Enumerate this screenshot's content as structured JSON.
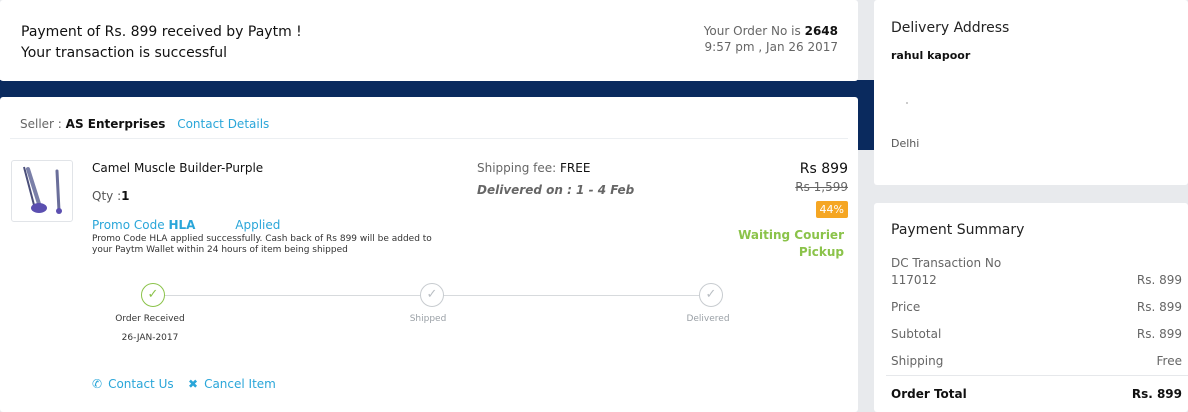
{
  "confirmation": {
    "line1": "Payment of Rs. 899 received by Paytm !",
    "line2": "Your transaction is successful",
    "order_no_label": "Your Order No is",
    "order_no": "2648",
    "timestamp": "9:57 pm , Jan 26 2017"
  },
  "order": {
    "seller_label": "Seller :",
    "seller_name": "AS Enterprises",
    "contact_details": "Contact Details",
    "product_name": "Camel Muscle Builder-Purple",
    "qty_label": "Qty :",
    "qty": "1",
    "promo_label": "Promo Code",
    "promo_code": "HLA",
    "promo_applied": "Applied",
    "promo_note": "Promo Code HLA                    applied successfully. Cash back of Rs 899 will be added to your Paytm Wallet within 24 hours of item being shipped",
    "shipping_fee_label": "Shipping fee:",
    "shipping_fee": "FREE",
    "delivery_text": "Delivered on : 1 - 4 Feb",
    "price": "Rs 899",
    "mrp": "Rs 1,599",
    "discount": "44%",
    "status": "Waiting Courier Pickup",
    "steps": [
      {
        "label": "Order Received",
        "date": "26-JAN-2017",
        "done": true
      },
      {
        "label": "Shipped",
        "date": "",
        "done": false
      },
      {
        "label": "Delivered",
        "date": "",
        "done": false
      }
    ],
    "contact_us": "Contact Us",
    "cancel_item": "Cancel Item",
    "colors": {
      "accent_blue": "#2aa6d9",
      "success_green": "#8bc34a",
      "discount_orange": "#f5a623",
      "navy": "#0a2a5e"
    }
  },
  "address": {
    "title": "Delivery Address",
    "name": "rahul kapoor",
    "city": "Delhi"
  },
  "payment": {
    "title": "Payment Summary",
    "rows": [
      {
        "label": "DC Transaction No",
        "label2": "117012",
        "value": "Rs. 899"
      },
      {
        "label": "Price",
        "value": "Rs. 899"
      },
      {
        "label": "Subtotal",
        "value": "Rs. 899"
      },
      {
        "label": "Shipping",
        "value": "Free"
      }
    ],
    "total_label": "Order Total",
    "total_value": "Rs. 899"
  }
}
